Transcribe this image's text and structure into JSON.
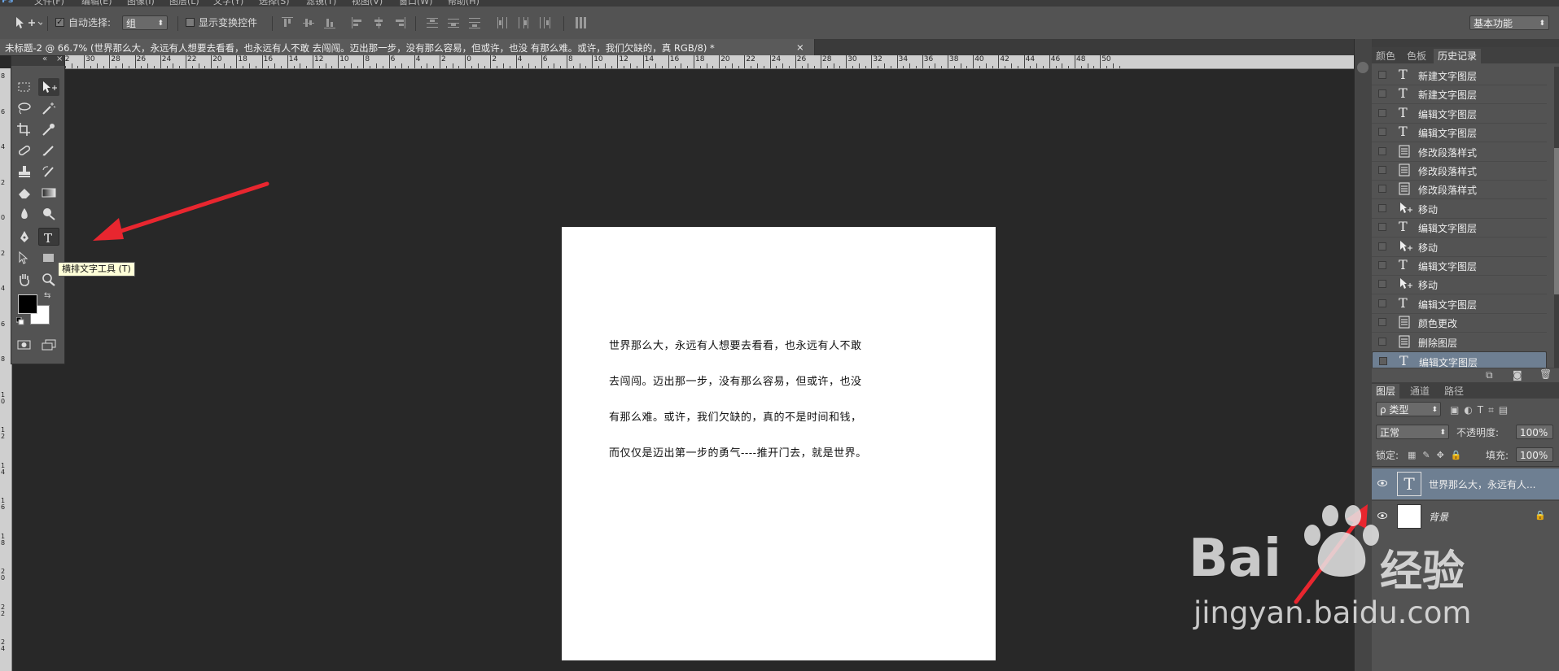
{
  "menubar": {
    "items": [
      "文件(F)",
      "编辑(E)",
      "图像(I)",
      "图层(L)",
      "文字(Y)",
      "选择(S)",
      "滤镜(T)",
      "视图(V)",
      "窗口(W)",
      "帮助(H)"
    ]
  },
  "options_bar": {
    "auto_select_label": "自动选择:",
    "auto_select_checked": true,
    "auto_select_value": "组",
    "show_transform_label": "显示变换控件",
    "show_transform_checked": false,
    "workspace_value": "基本功能"
  },
  "document_tab": {
    "title": "未标题-2 @ 66.7% (世界那么大，永远有人想要去看看，也永远有人不敢 去闯闯。迈出那一步，没有那么容易，但或许，也没 有那么难。或许，我们欠缺的，真 RGB/8) *",
    "close_label": "×"
  },
  "rulers": {
    "horizontal_labels": [
      "32",
      "30",
      "28",
      "26",
      "24",
      "22",
      "20",
      "18",
      "16",
      "14",
      "12",
      "10",
      "8",
      "6",
      "4",
      "2",
      "0",
      "2",
      "4",
      "6",
      "8",
      "10",
      "12",
      "14",
      "16",
      "18",
      "20",
      "22",
      "24",
      "26",
      "28",
      "30",
      "32",
      "34",
      "36",
      "38",
      "40",
      "42",
      "44",
      "46",
      "48",
      "50"
    ],
    "vertical_labels": [
      "8",
      "6",
      "4",
      "2",
      "0",
      "2",
      "4",
      "6",
      "8",
      "10",
      "12",
      "14",
      "16",
      "18",
      "20",
      "22",
      "24"
    ]
  },
  "canvas": {
    "lines": [
      "世界那么大，永远有人想要去看看，也永远有人不敢",
      "去闯闯。迈出那一步，没有那么容易，但或许，也没",
      "有那么难。或许，我们欠缺的，真的不是时间和钱，",
      "而仅仅是迈出第一步的勇气----推开门去，就是世界。"
    ]
  },
  "tooltip": {
    "text": "横排文字工具 (T)"
  },
  "history_panel": {
    "tabs": [
      "颜色",
      "色板",
      "历史记录"
    ],
    "active_tab": "历史记录",
    "items": [
      {
        "icon": "T",
        "label": "新建文字图层"
      },
      {
        "icon": "T",
        "label": "新建文字图层"
      },
      {
        "icon": "T",
        "label": "编辑文字图层"
      },
      {
        "icon": "T",
        "label": "编辑文字图层"
      },
      {
        "icon": "doc",
        "label": "修改段落样式"
      },
      {
        "icon": "doc",
        "label": "修改段落样式"
      },
      {
        "icon": "doc",
        "label": "修改段落样式"
      },
      {
        "icon": "move",
        "label": "移动"
      },
      {
        "icon": "T",
        "label": "编辑文字图层"
      },
      {
        "icon": "move",
        "label": "移动"
      },
      {
        "icon": "T",
        "label": "编辑文字图层"
      },
      {
        "icon": "move",
        "label": "移动"
      },
      {
        "icon": "T",
        "label": "编辑文字图层"
      },
      {
        "icon": "doc",
        "label": "颜色更改"
      },
      {
        "icon": "doc",
        "label": "删除图层"
      },
      {
        "icon": "T",
        "label": "编辑文字图层"
      }
    ],
    "selected_index": 15
  },
  "layers_panel": {
    "tabs": [
      "图层",
      "通道",
      "路径"
    ],
    "active_tab": "图层",
    "filter_label": "ρ 类型",
    "blend_mode": "正常",
    "opacity_label": "不透明度:",
    "opacity_value": "100%",
    "lock_label": "锁定:",
    "fill_label": "填充:",
    "fill_value": "100%",
    "layers": [
      {
        "thumb": "T",
        "name": "世界那么大，永远有人..."
      },
      {
        "thumb": "",
        "name": "背景"
      }
    ]
  },
  "watermark": {
    "brand": "Bai",
    "brand2": "经验",
    "url": "jingyan.baidu.com"
  },
  "colors": {
    "arrow": "#e8262f",
    "selected_row": "#6e7f92"
  }
}
